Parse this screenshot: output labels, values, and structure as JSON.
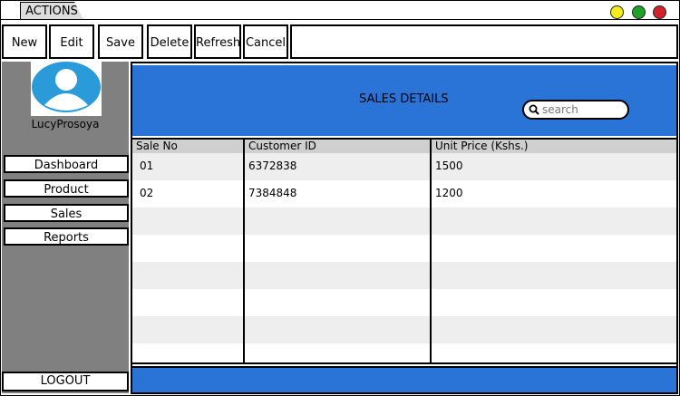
{
  "window": {
    "tab_label": "ACTIONS",
    "controls": {
      "yellow": "#f2ec1b",
      "green": "#22a12a",
      "red": "#d1242a"
    }
  },
  "toolbar": {
    "buttons": [
      {
        "label": "New"
      },
      {
        "label": "Edit"
      },
      {
        "label": "Save"
      },
      {
        "label": "Delete"
      },
      {
        "label": "Refresh"
      },
      {
        "label": "Cancel"
      }
    ]
  },
  "sidebar": {
    "user_name": "LucyProsoya",
    "items": [
      {
        "label": "Dashboard"
      },
      {
        "label": "Product"
      },
      {
        "label": "Sales"
      },
      {
        "label": "Reports"
      }
    ],
    "logout_label": "LOGOUT"
  },
  "main": {
    "title": "SALES DETAILS",
    "search_placeholder": "search",
    "accent_color": "#2a74d8",
    "columns": [
      "Sale No",
      "Customer ID",
      "Unit Price (Kshs.)"
    ],
    "rows": [
      {
        "sale_no": "01",
        "customer_id": "6372838",
        "unit_price": "1500"
      },
      {
        "sale_no": "02",
        "customer_id": "7384848",
        "unit_price": "1200"
      }
    ]
  }
}
